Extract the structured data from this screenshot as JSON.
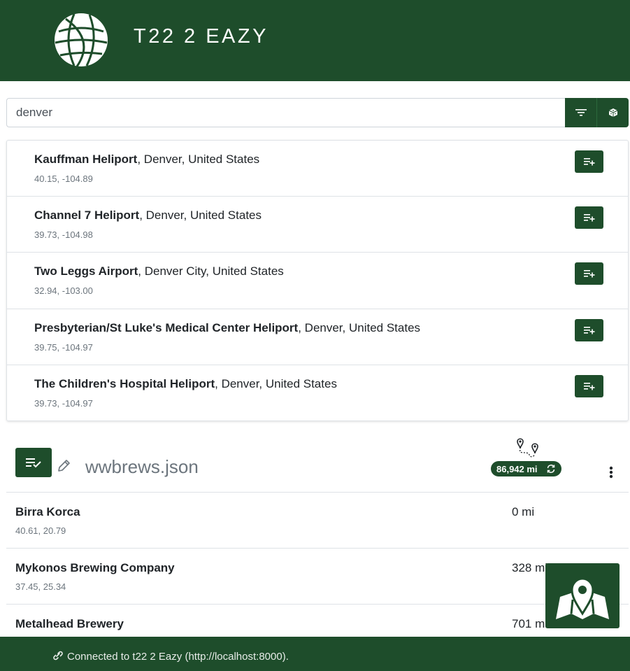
{
  "header": {
    "title": "T22 2 EAZY",
    "logo_icon": "globe-icon",
    "color": "#1e4d2b"
  },
  "search": {
    "value": "denver",
    "placeholder": "",
    "filter_icon": "filter-icon",
    "random_icon": "dice-icon"
  },
  "results": [
    {
      "name": "Kauffman Heliport",
      "location": ", Denver, United States",
      "coords": "40.15, -104.89"
    },
    {
      "name": "Channel 7 Heliport",
      "location": ", Denver, United States",
      "coords": "39.73, -104.98"
    },
    {
      "name": "Two Leggs Airport",
      "location": ", Denver City, United States",
      "coords": "32.94, -103.00"
    },
    {
      "name": "Presbyterian/St Luke's Medical Center Heliport",
      "location": ", Denver, United States",
      "coords": "39.75, -104.97"
    },
    {
      "name": "The Children's Hospital Heliport",
      "location": ", Denver, United States",
      "coords": "39.73, -104.97"
    }
  ],
  "trip": {
    "name": "wwbrews.json",
    "total_distance": "86,942 mi",
    "places": [
      {
        "name": "Birra Korca",
        "coords": "40.61, 20.79",
        "distance": "0 mi"
      },
      {
        "name": "Mykonos Brewing Company",
        "coords": "37.45, 25.34",
        "distance": "328 mi"
      },
      {
        "name": "Metalhead Brewery",
        "coords": "",
        "distance": "701 mi"
      }
    ]
  },
  "footer": {
    "status": "Connected to t22 2 Eazy  (http://localhost:8000)."
  }
}
